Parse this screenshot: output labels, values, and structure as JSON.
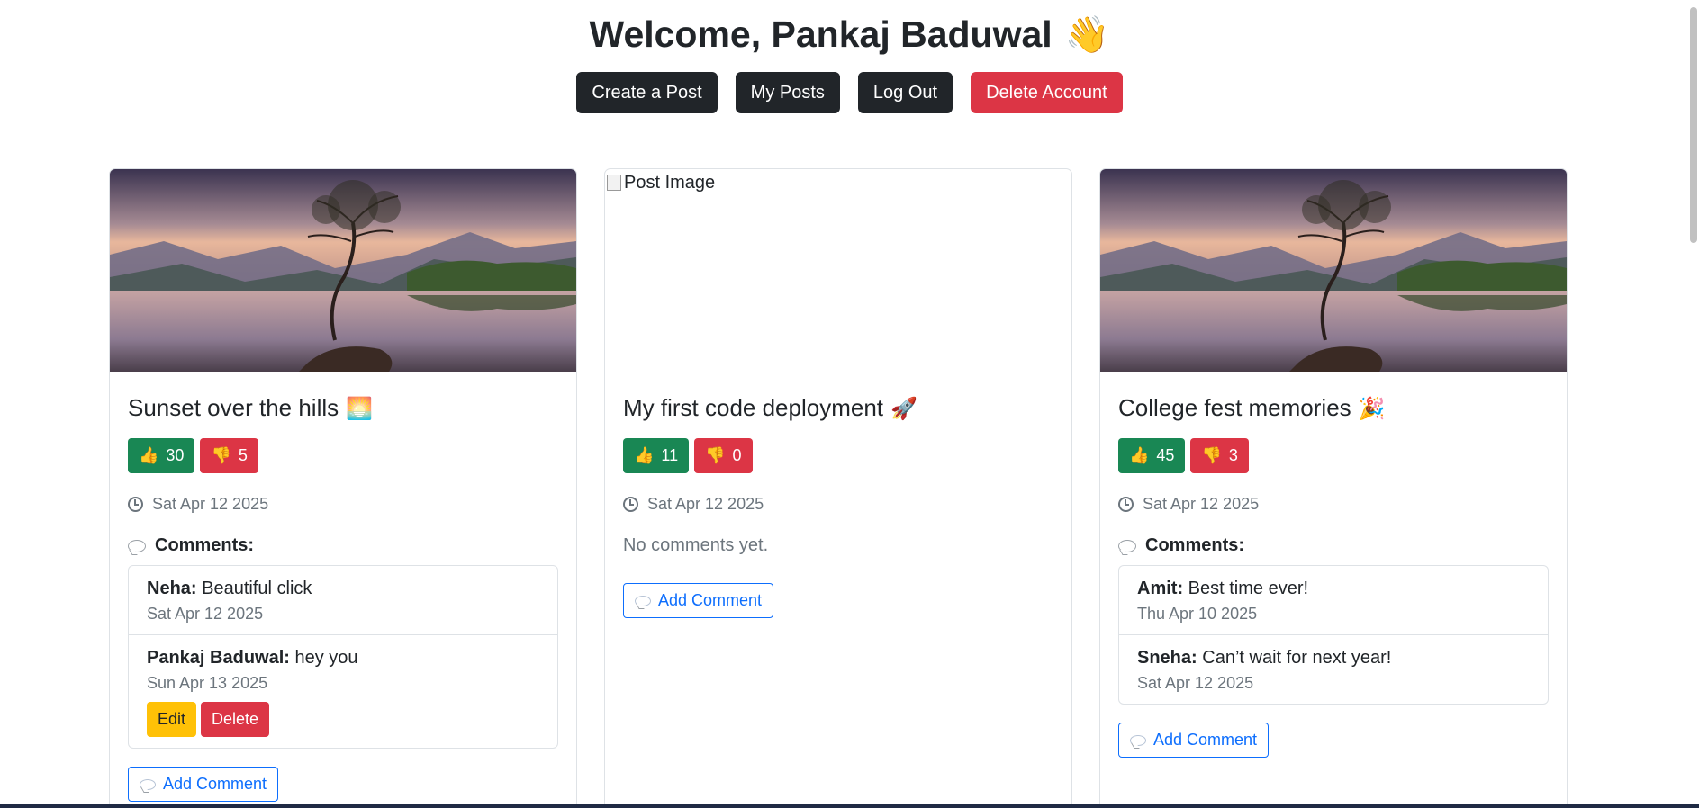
{
  "header": {
    "greeting": "Welcome, Pankaj Baduwal",
    "wave_emoji": "👋"
  },
  "nav": {
    "create_post": "Create a Post",
    "my_posts": "My Posts",
    "log_out": "Log Out",
    "delete_account": "Delete Account"
  },
  "icons": {
    "thumbs_up": "👍",
    "thumbs_down": "👎"
  },
  "posts": [
    {
      "title": "Sunset over the hills",
      "emoji": "🌅",
      "likes": "30",
      "dislikes": "5",
      "date": "Sat Apr 12 2025",
      "comments_heading": "Comments:",
      "comments": [
        {
          "author": "Neha:",
          "text": "Beautiful click",
          "date": "Sat Apr 12 2025"
        },
        {
          "author": "Pankaj Baduwal:",
          "text": "hey you",
          "date": "Sun Apr 13 2025",
          "edit_label": "Edit",
          "delete_label": "Delete"
        }
      ],
      "add_comment": "Add Comment"
    },
    {
      "title": "My first code deployment",
      "emoji": "🚀",
      "image_alt": "Post Image",
      "likes": "11",
      "dislikes": "0",
      "date": "Sat Apr 12 2025",
      "no_comments": "No comments yet.",
      "add_comment": "Add Comment"
    },
    {
      "title": "College fest memories",
      "emoji": "🎉",
      "likes": "45",
      "dislikes": "3",
      "date": "Sat Apr 12 2025",
      "comments_heading": "Comments:",
      "comments": [
        {
          "author": "Amit:",
          "text": "Best time ever!",
          "date": "Thu Apr 10 2025"
        },
        {
          "author": "Sneha:",
          "text": "Can’t wait for next year!",
          "date": "Sat Apr 12 2025"
        }
      ],
      "add_comment": "Add Comment"
    }
  ],
  "colors": {
    "dark": "#212529",
    "danger": "#dc3545",
    "success": "#198754",
    "warning": "#ffc107",
    "primary": "#0d6efd",
    "muted": "#6c757d"
  }
}
